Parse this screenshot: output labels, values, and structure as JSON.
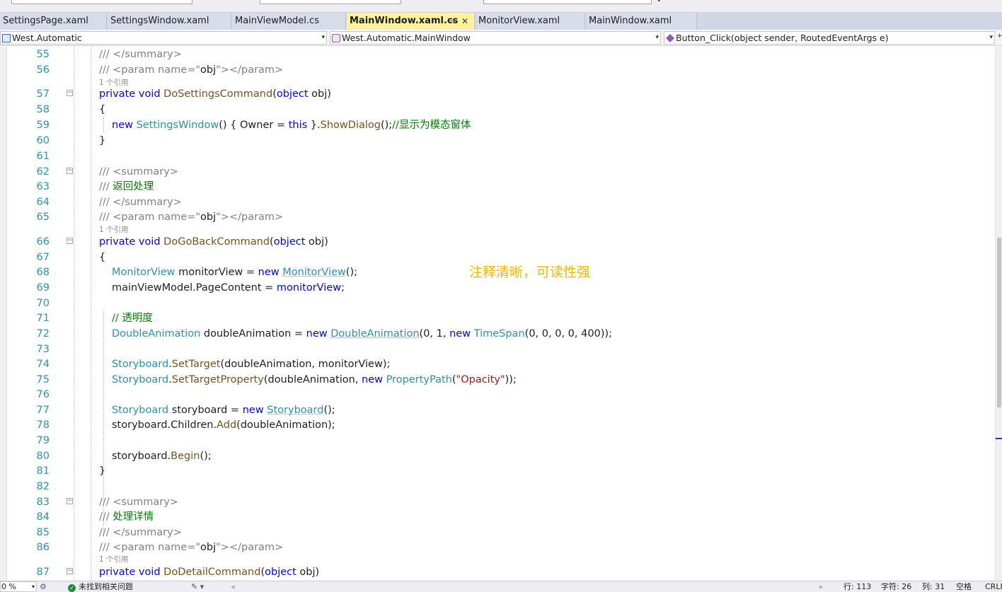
{
  "tabs": [
    {
      "label": "SettingsPage.xaml"
    },
    {
      "label": "SettingsWindow.xaml"
    },
    {
      "label": "MainViewModel.cs"
    },
    {
      "label": "MainWindow.xaml.cs",
      "pin": "⊸",
      "close": "✕"
    },
    {
      "label": "MonitorView.xaml"
    },
    {
      "label": "MainWindow.xaml"
    }
  ],
  "tab_overflow": "▾",
  "navbar": {
    "project": "West.Automatic",
    "class": "West.Automatic.MainWindow",
    "member": "Button_Click(object sender, RoutedEventArgs e)"
  },
  "lines": [
    {
      "n": "55",
      "parts": [
        [
          "x",
          "/// </summary>"
        ]
      ]
    },
    {
      "n": "56",
      "parts": [
        [
          "x",
          "/// <param name=\""
        ],
        [
          "",
          "obj"
        ],
        [
          "x",
          "\"></param>"
        ]
      ]
    },
    {
      "n": "57",
      "parts": [
        [
          "k",
          "private void "
        ],
        [
          "m",
          "DoSettingsCommand"
        ],
        [
          "",
          "("
        ],
        [
          "k",
          "object"
        ],
        [
          "",
          " obj)"
        ]
      ]
    },
    {
      "n": "58",
      "parts": [
        [
          "",
          "{"
        ]
      ]
    },
    {
      "n": "59",
      "parts": [
        [
          "k",
          "new "
        ],
        [
          "t",
          "SettingsWindow"
        ],
        [
          "",
          "() { Owner = "
        ],
        [
          "k",
          "this"
        ],
        [
          "",
          " }."
        ],
        [
          "m",
          "ShowDialog"
        ],
        [
          "",
          "();"
        ],
        [
          "c",
          "//显示为模态窗体"
        ]
      ]
    },
    {
      "n": "60",
      "parts": [
        [
          "",
          "}"
        ]
      ]
    },
    {
      "n": "61",
      "parts": []
    },
    {
      "n": "62",
      "parts": [
        [
          "x",
          "/// <summary>"
        ]
      ]
    },
    {
      "n": "63",
      "parts": [
        [
          "x",
          "/// "
        ],
        [
          "c",
          "返回处理"
        ]
      ]
    },
    {
      "n": "64",
      "parts": [
        [
          "x",
          "/// </summary>"
        ]
      ]
    },
    {
      "n": "65",
      "parts": [
        [
          "x",
          "/// <param name=\""
        ],
        [
          "",
          "obj"
        ],
        [
          "x",
          "\"></param>"
        ]
      ]
    },
    {
      "n": "66",
      "parts": [
        [
          "k",
          "private void "
        ],
        [
          "m",
          "DoGoBackCommand"
        ],
        [
          "",
          "("
        ],
        [
          "k",
          "object"
        ],
        [
          "",
          " obj)"
        ]
      ]
    },
    {
      "n": "67",
      "parts": [
        [
          "",
          "{"
        ]
      ]
    },
    {
      "n": "68",
      "parts": [
        [
          "t",
          "MonitorView"
        ],
        [
          "",
          " monitorView = "
        ],
        [
          "k",
          "new "
        ],
        [
          "tu",
          "MonitorView"
        ],
        [
          "",
          "();"
        ]
      ]
    },
    {
      "n": "69",
      "parts": [
        [
          "",
          "mainViewModel.PageContent = "
        ],
        [
          "k",
          "monitorView"
        ],
        [
          "",
          ";"
        ]
      ]
    },
    {
      "n": "70",
      "parts": []
    },
    {
      "n": "71",
      "parts": [
        [
          "c",
          "// 透明度"
        ]
      ]
    },
    {
      "n": "72",
      "parts": [
        [
          "t",
          "DoubleAnimation"
        ],
        [
          "",
          " doubleAnimation = "
        ],
        [
          "k",
          "new "
        ],
        [
          "tu",
          "DoubleAnimation"
        ],
        [
          "",
          "(0, 1, "
        ],
        [
          "k",
          "new "
        ],
        [
          "t",
          "TimeSpan"
        ],
        [
          "",
          "(0, 0, 0, 0, 400));"
        ]
      ]
    },
    {
      "n": "73",
      "parts": []
    },
    {
      "n": "74",
      "parts": [
        [
          "t",
          "Storyboard"
        ],
        [
          "",
          "."
        ],
        [
          "m",
          "SetTarget"
        ],
        [
          "",
          "(doubleAnimation, monitorView);"
        ]
      ]
    },
    {
      "n": "75",
      "parts": [
        [
          "t",
          "Storyboard"
        ],
        [
          "",
          "."
        ],
        [
          "m",
          "SetTargetProperty"
        ],
        [
          "",
          "(doubleAnimation, "
        ],
        [
          "k",
          "new "
        ],
        [
          "t",
          "PropertyPath"
        ],
        [
          "",
          "("
        ],
        [
          "s",
          "\"Opacity\""
        ],
        [
          "",
          "));"
        ]
      ]
    },
    {
      "n": "76",
      "parts": []
    },
    {
      "n": "77",
      "parts": [
        [
          "t",
          "Storyboard"
        ],
        [
          "",
          " storyboard = "
        ],
        [
          "k",
          "new "
        ],
        [
          "tu",
          "Storyboard"
        ],
        [
          "",
          "();"
        ]
      ]
    },
    {
      "n": "78",
      "parts": [
        [
          "",
          "storyboard.Children."
        ],
        [
          "m",
          "Add"
        ],
        [
          "",
          "(doubleAnimation);"
        ]
      ]
    },
    {
      "n": "79",
      "parts": []
    },
    {
      "n": "80",
      "parts": [
        [
          "",
          "storyboard."
        ],
        [
          "m",
          "Begin"
        ],
        [
          "",
          "();"
        ]
      ]
    },
    {
      "n": "81",
      "parts": [
        [
          "",
          "}"
        ]
      ]
    },
    {
      "n": "82",
      "parts": []
    },
    {
      "n": "83",
      "parts": [
        [
          "x",
          "/// <summary>"
        ]
      ]
    },
    {
      "n": "84",
      "parts": [
        [
          "x",
          "/// "
        ],
        [
          "c",
          "处理详情"
        ]
      ]
    },
    {
      "n": "85",
      "parts": [
        [
          "x",
          "/// </summary>"
        ]
      ]
    },
    {
      "n": "86",
      "parts": [
        [
          "x",
          "/// <param name=\""
        ],
        [
          "",
          "obj"
        ],
        [
          "x",
          "\"></param>"
        ]
      ]
    },
    {
      "n": "87",
      "parts": [
        [
          "k",
          "private void "
        ],
        [
          "m",
          "DoDetailCommand"
        ],
        [
          "",
          "("
        ],
        [
          "k",
          "object"
        ],
        [
          "",
          " obj)"
        ]
      ]
    }
  ],
  "codelens": "1 个引用",
  "annotation": "注释清晰，可读性强",
  "status": {
    "zoom": "0 %",
    "issues": "未找到相关问题",
    "line": "行: 113",
    "char": "字符: 26",
    "col": "列: 31",
    "spaces": "空格",
    "eol": "CRLF"
  },
  "colors": {
    "keyword": "#0000ff",
    "type": "#2b91af",
    "method": "#74531f",
    "comment": "#008000",
    "doc_tag": "#808080",
    "string": "#a31515",
    "active_tab": "#fff29d",
    "annotation": "#f5b400"
  }
}
